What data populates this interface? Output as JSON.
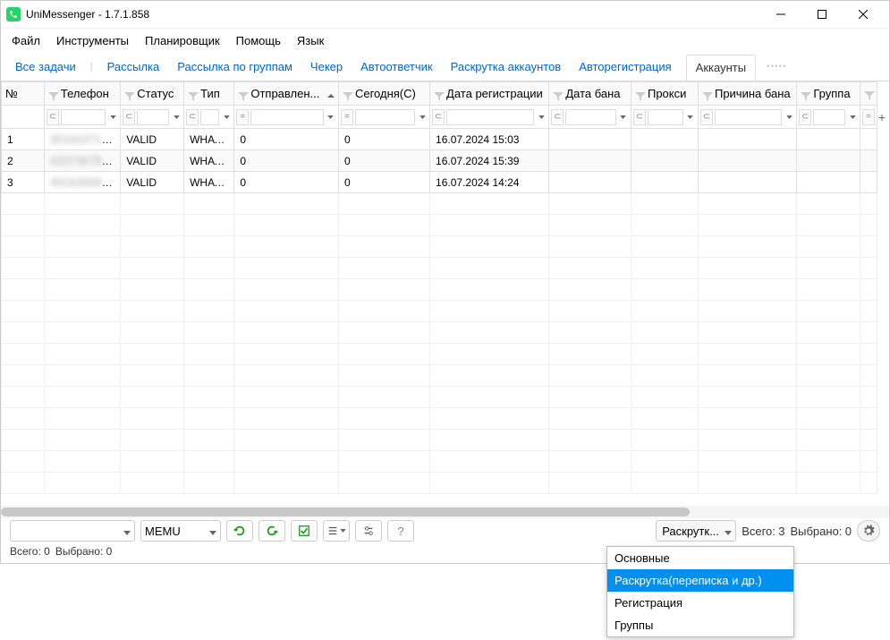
{
  "window": {
    "title": "UniMessenger - 1.7.1.858"
  },
  "menu": {
    "file": "Файл",
    "tools": "Инструменты",
    "scheduler": "Планировщик",
    "help": "Помощь",
    "lang": "Язык"
  },
  "tabs": {
    "all": "Все задачи",
    "mail": "Рассылка",
    "groups": "Рассылка по группам",
    "checker": "Чекер",
    "autoreply": "Автоответчик",
    "promote": "Раскрутка аккаунтов",
    "autoreg": "Авторегистрация",
    "accounts": "Аккаунты"
  },
  "columns": {
    "num": "№",
    "phone": "Телефон",
    "status": "Статус",
    "type": "Тип",
    "sent": "Отправлен...",
    "today": "Сегодня(С)",
    "regdate": "Дата регистрации",
    "bandate": "Дата бана",
    "proxy": "Прокси",
    "banreason": "Причина бана",
    "group": "Группа"
  },
  "filter_ops": {
    "contains": "⊂",
    "equals": "="
  },
  "rows": [
    {
      "n": "1",
      "phone": "351910715296",
      "status": "VALID",
      "type": "WHATS...",
      "sent": "0",
      "today": "0",
      "regdate": "16.07.2024 15:03"
    },
    {
      "n": "2",
      "phone": "420736780791",
      "status": "VALID",
      "type": "WHATS...",
      "sent": "0",
      "today": "0",
      "regdate": "16.07.2024 15:39"
    },
    {
      "n": "3",
      "phone": "491630088436",
      "status": "VALID",
      "type": "WHATS...",
      "sent": "0",
      "today": "0",
      "regdate": "16.07.2024 14:24"
    }
  ],
  "bottom": {
    "emu": "MEMU",
    "question": "?",
    "sel_label": "Раскрутк...",
    "total_label": "Всего:",
    "total_val": "3",
    "selected_label": "Выбрано:",
    "selected_val": "0",
    "status2_total": "Всего: 0",
    "status2_sel": "Выбрано: 0"
  },
  "dropdown": {
    "i1": "Основные",
    "i2": "Раскрутка(переписка и др.)",
    "i3": "Регистрация",
    "i4": "Группы"
  }
}
